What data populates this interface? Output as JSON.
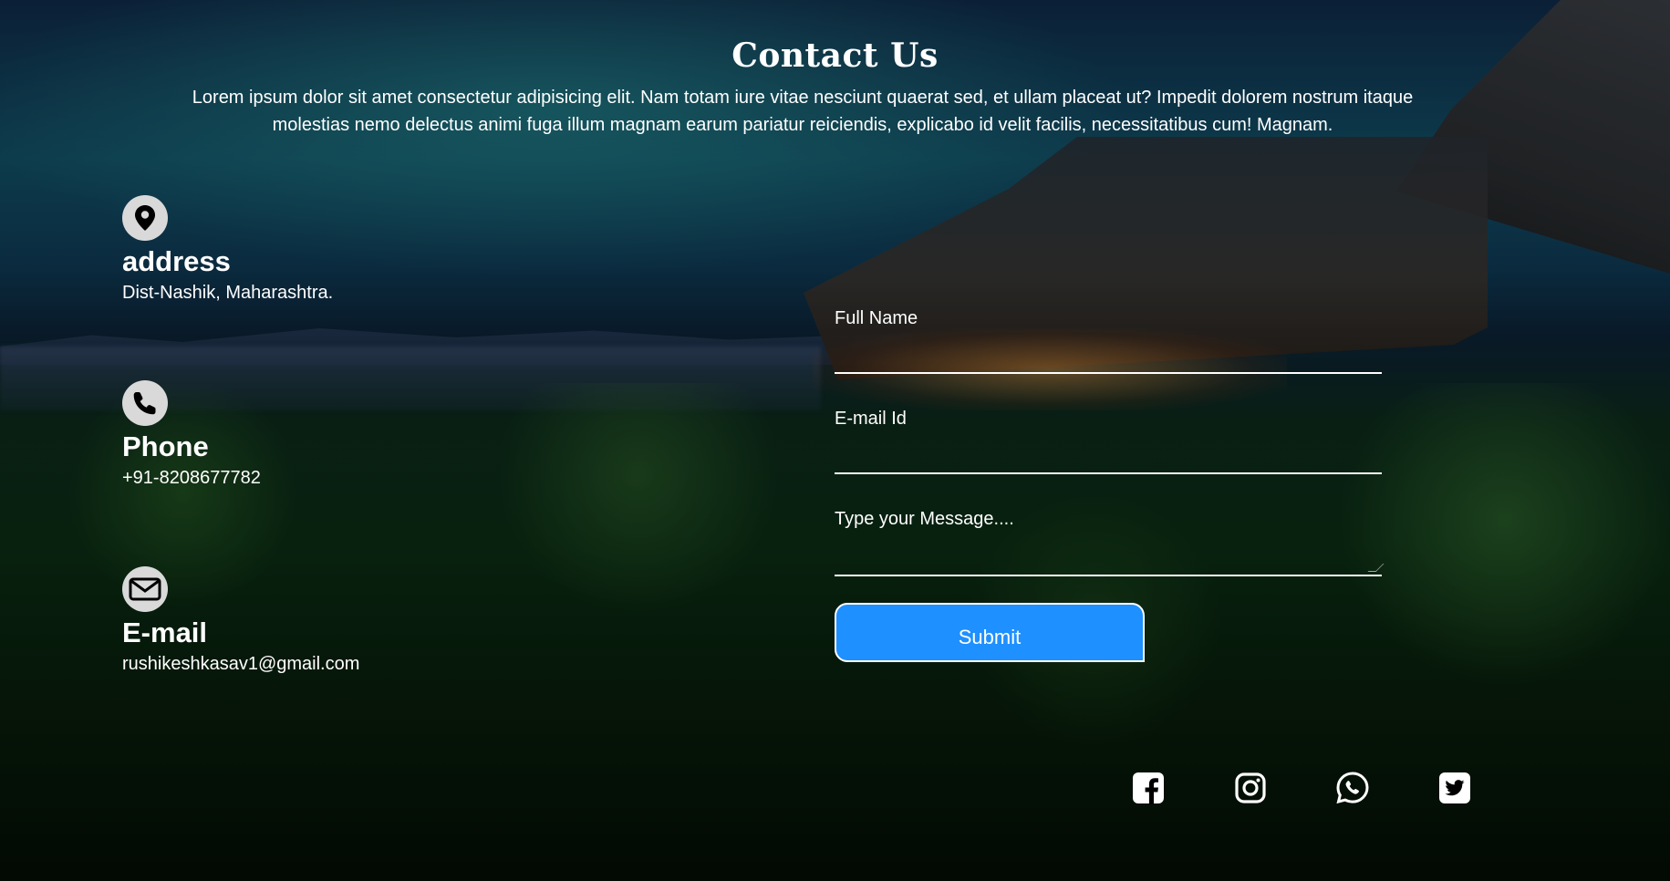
{
  "header": {
    "title": "Contact Us",
    "intro": "Lorem ipsum dolor sit amet consectetur adipisicing elit. Nam totam iure vitae nesciunt quaerat sed, et ullam placeat ut? Impedit dolorem nostrum itaque molestias nemo delectus animi fuga illum magnam earum pariatur reiciendis, explicabo id velit facilis, necessitatibus cum! Magnam."
  },
  "contact_info": {
    "address": {
      "icon": "location-pin-icon",
      "label": "address",
      "value": "Dist-Nashik, Maharashtra."
    },
    "phone": {
      "icon": "phone-icon",
      "label": "Phone",
      "value": "+91-8208677782"
    },
    "email": {
      "icon": "envelope-icon",
      "label": "E-mail",
      "value": "rushikeshkasav1@gmail.com"
    }
  },
  "form": {
    "full_name": {
      "placeholder": "Full Name",
      "value": ""
    },
    "email": {
      "placeholder": "E-mail Id",
      "value": ""
    },
    "message": {
      "placeholder": "Type your Message....",
      "value": ""
    },
    "submit_label": "Submit",
    "submit_color": "#1e90ff"
  },
  "social": [
    {
      "icon": "facebook-icon"
    },
    {
      "icon": "instagram-icon"
    },
    {
      "icon": "whatsapp-icon"
    },
    {
      "icon": "twitter-icon"
    }
  ]
}
